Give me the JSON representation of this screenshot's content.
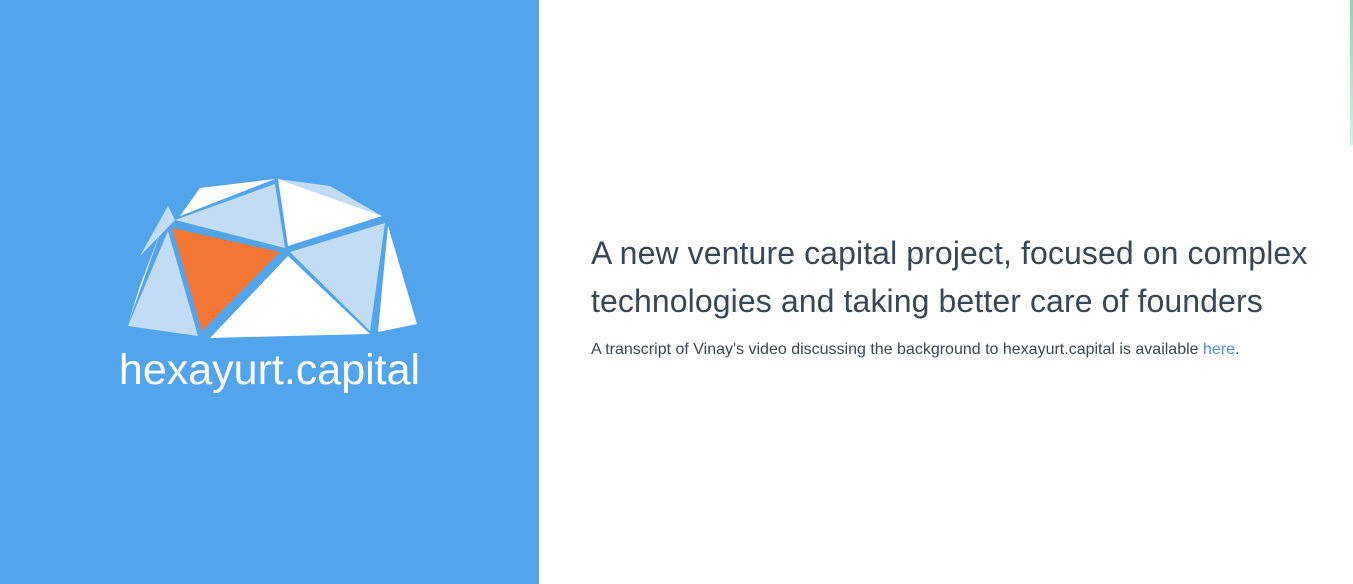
{
  "brand": {
    "name": "hexayurt.capital",
    "logo_icon": "hexayurt-dome-icon",
    "colors": {
      "panel": "#52a4ec",
      "accent": "#f47735",
      "light_facet": "#c3dcf6",
      "white_facet": "#ffffff"
    }
  },
  "main": {
    "headline": "A new venture capital project, focused on complex technologies and taking better care of founders",
    "transcript_prefix": "A transcript of Vinay's video discussing the background to hexayurt.capital is available ",
    "transcript_link": "here",
    "transcript_suffix": ".",
    "link_color": "#4a90e2",
    "text_color": "#374755"
  }
}
